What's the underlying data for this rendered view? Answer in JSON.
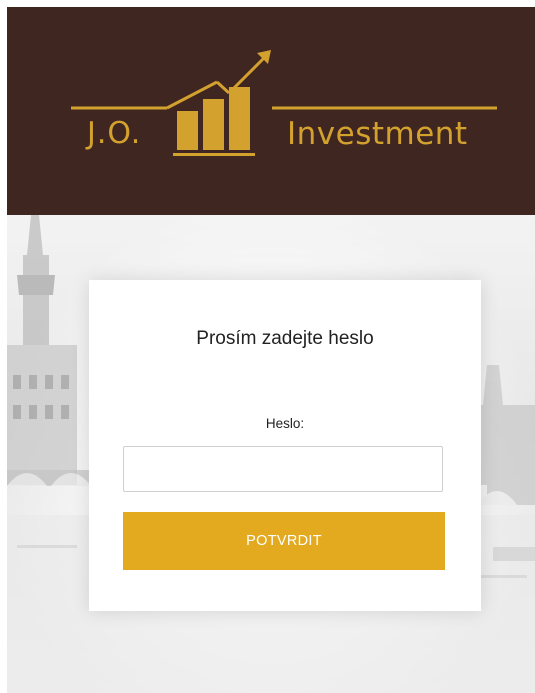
{
  "header": {
    "brand_left": "J.O.",
    "brand_right": "Investment",
    "background_color": "#3f2621",
    "accent_color": "#d3a12d",
    "logo_icon": "bar-chart-arrow-icon"
  },
  "login": {
    "title": "Prosím zadejte heslo",
    "password_label": "Heslo:",
    "password_value": "",
    "password_placeholder": "",
    "submit_label": "POTVRDIT",
    "button_color": "#e3a91f"
  },
  "background": {
    "image": "prague-city-skyline"
  }
}
